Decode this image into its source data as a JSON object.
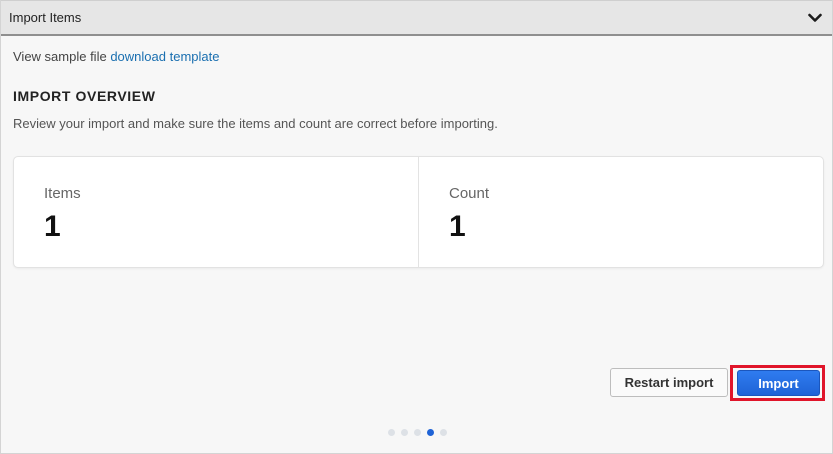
{
  "header": {
    "title": "Import Items"
  },
  "sample": {
    "prefix": "View sample file",
    "link_label": "download template"
  },
  "overview": {
    "title": "IMPORT OVERVIEW",
    "description": "Review your import and make sure the items and count are correct before importing."
  },
  "stats": [
    {
      "label": "Items",
      "value": "1"
    },
    {
      "label": "Count",
      "value": "1"
    }
  ],
  "actions": {
    "restart_label": "Restart import",
    "import_label": "Import"
  },
  "pager": {
    "total": 5,
    "active_index": 3
  },
  "colors": {
    "accent": "#1f63d6",
    "highlight": "#e0152a",
    "link": "#1a6fb0"
  }
}
